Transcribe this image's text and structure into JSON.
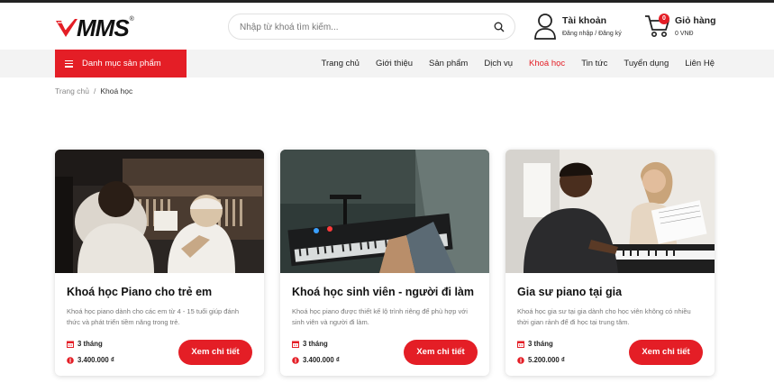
{
  "brand": {
    "logo_text": "MMS",
    "reg_mark": "®"
  },
  "search": {
    "placeholder": "Nhập từ khoá tìm kiếm..."
  },
  "account": {
    "title": "Tài khoản",
    "subtitle": "Đăng nhập / Đăng ký"
  },
  "cart": {
    "title": "Giỏ hàng",
    "total": "0 VNĐ",
    "count": "0"
  },
  "category_button": {
    "label": "Danh mục sản phẩm"
  },
  "nav": {
    "items": [
      {
        "label": "Trang chủ"
      },
      {
        "label": "Giới thiệu"
      },
      {
        "label": "Sản phẩm"
      },
      {
        "label": "Dịch vụ"
      },
      {
        "label": "Khoá học"
      },
      {
        "label": "Tin tức"
      },
      {
        "label": "Tuyển dụng"
      },
      {
        "label": "Liên Hệ"
      }
    ],
    "active_index": 4
  },
  "breadcrumb": {
    "home": "Trang chủ",
    "separator": "/",
    "current": "Khoá học"
  },
  "courses": [
    {
      "title": "Khoá học Piano cho trẻ em",
      "description": "Khoá học piano dành cho các em từ 4 - 15 tuổi giúp đánh thức và phát triển tiềm năng trong trẻ.",
      "duration": "3 tháng",
      "price": "3.400.000 ₫",
      "button": "Xem chi tiết",
      "image_icon": "kids-piano-photo"
    },
    {
      "title": "Khoá học sinh viên - người đi làm",
      "description": "Khoá học piano được thiết kế lộ trình riêng để phù hợp với sinh viên và người đi làm.",
      "duration": "3 tháng",
      "price": "3.400.000 ₫",
      "button": "Xem chi tiết",
      "image_icon": "keyboard-photo"
    },
    {
      "title": "Gia sư piano tại gia",
      "description": "Khoá học gia sư tại gia dành cho học viên không có nhiều thời gian rảnh để đi học tại trung tâm.",
      "duration": "3 tháng",
      "price": "5.200.000 ₫",
      "button": "Xem chi tiết",
      "image_icon": "tutor-piano-photo"
    }
  ],
  "colors": {
    "accent": "#e41e26",
    "nav_bg": "#f3f3f3",
    "text": "#222222",
    "muted": "#777777"
  }
}
